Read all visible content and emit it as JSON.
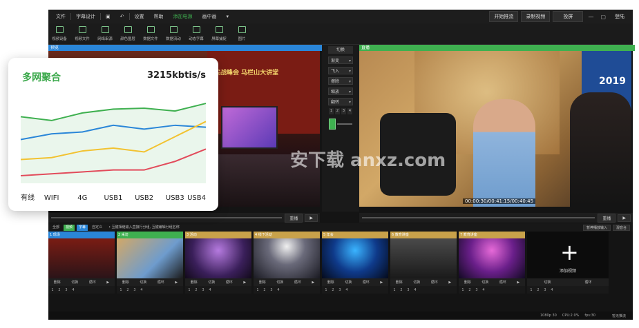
{
  "menu": {
    "items": [
      "文件",
      "字幕设计",
      "设置",
      "帮助",
      "添加电源",
      "画中画"
    ],
    "active_index": 4,
    "start_stream": "开始推流",
    "record": "录制视频",
    "projector": "投屏",
    "login": "登陆"
  },
  "toolbar": {
    "items": [
      "视频设备",
      "视频文件",
      "网络串源",
      "颜色图层",
      "数据文件",
      "数据流动",
      "动态字幕",
      "屏幕捕捉",
      "图片"
    ]
  },
  "preview": {
    "left_label": "预览",
    "right_label": "直播",
    "right_timecode": "00:00:30/00:41:15/00:40:45",
    "left_banner": "实战峰会 马栏山大讲堂",
    "right_year": "2019"
  },
  "transition": {
    "cut_label": "切换",
    "options": [
      "渐变",
      "飞入",
      "擦除",
      "缩放",
      "翻转"
    ],
    "numbers": [
      "1",
      "2",
      "3",
      "4"
    ]
  },
  "controls": {
    "replay_left": "重播",
    "replay_right": "重播",
    "pause_input": "暂停播放输入",
    "audio": "混音台"
  },
  "tabs": {
    "items": [
      "全部",
      "视频",
      "字幕",
      "自定义"
    ],
    "hint": "• 互键相继输入直接行分组, 互键编辑分组名称"
  },
  "clips": [
    {
      "number": "1",
      "name": "现场",
      "color": "#2a86d8"
    },
    {
      "number": "2",
      "name": "采访",
      "color": "#3fb050"
    },
    {
      "number": "3",
      "name": "活动",
      "color": "#c9a24a"
    },
    {
      "number": "4",
      "name": "线下活动",
      "color": "#c9a24a"
    },
    {
      "number": "5",
      "name": "年会",
      "color": "#c9a24a"
    },
    {
      "number": "6",
      "name": "教育讲座",
      "color": "#c9a24a"
    },
    {
      "number": "7",
      "name": "教育讲座",
      "color": "#c9a24a"
    }
  ],
  "clip_controls": [
    "删除",
    "切换",
    "循环"
  ],
  "clip_numbers": [
    "1",
    "2",
    "3",
    "4"
  ],
  "add_video": "添加视频",
  "status": {
    "resolution": "1080p 30",
    "cpu": "CPU:2.0%",
    "fps": "fps:30",
    "stream_state": "暂无推流"
  },
  "overlay_card": {
    "title": "多网聚合",
    "rate": "3215kbtis/s",
    "categories": [
      "有线",
      "WIFI",
      "4G",
      "USB1",
      "USB2",
      "USB3",
      "USB4"
    ]
  },
  "chart_data": {
    "type": "area",
    "categories": [
      "有线",
      "WIFI",
      "4G",
      "USB1",
      "USB2",
      "USB3",
      "USB4"
    ],
    "series": [
      {
        "color": "#3fb050",
        "values": [
          70,
          66,
          74,
          78,
          79,
          76,
          84
        ]
      },
      {
        "color": "#2a86d8",
        "values": [
          46,
          52,
          54,
          61,
          57,
          61,
          59
        ]
      },
      {
        "color": "#f2c230",
        "values": [
          25,
          27,
          34,
          37,
          33,
          49,
          65
        ]
      },
      {
        "color": "#e24b5b",
        "values": [
          8,
          10,
          12,
          14,
          14,
          23,
          36
        ]
      }
    ],
    "ylim": [
      0,
      100
    ],
    "grid": false
  },
  "watermark": "安下载 anxz.com",
  "colors": {
    "accent": "#3fb050",
    "preview": "#2a86d8",
    "live": "#3fb050"
  }
}
